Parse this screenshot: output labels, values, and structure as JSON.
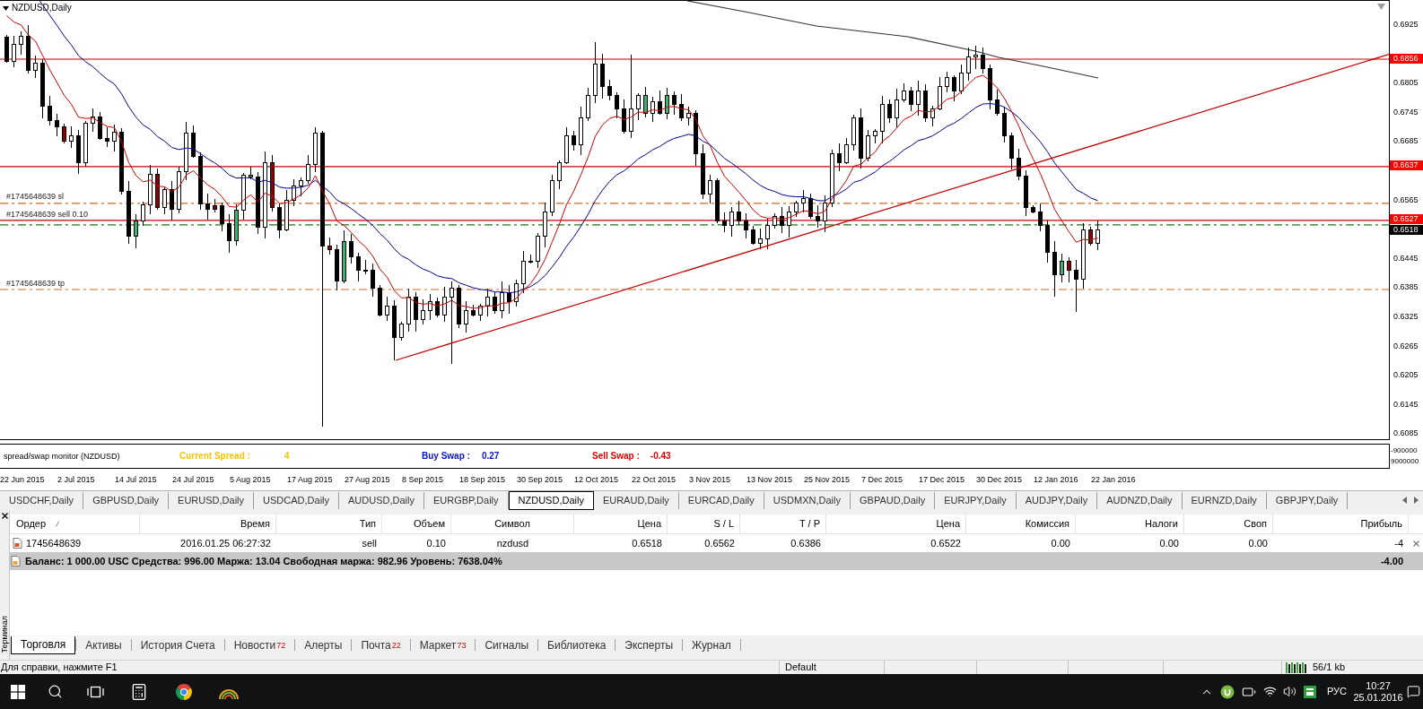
{
  "chart": {
    "title": "NZDUSD,Daily",
    "order_labels": [
      "#1745648639 sl",
      "#1745648639 sell 0.10",
      "#1745648639 tp"
    ],
    "price_axis": [
      "0.6925",
      "0.6805",
      "0.6745",
      "0.6685",
      "0.6565",
      "0.6445",
      "0.6385",
      "0.6325",
      "0.6265",
      "0.6205",
      "0.6145",
      "0.6085"
    ],
    "price_tags": [
      {
        "text": "0.6856",
        "kind": "level"
      },
      {
        "text": "0.6637",
        "kind": "level"
      },
      {
        "text": "0.6527",
        "kind": "level"
      },
      {
        "text": "0.6518",
        "kind": "bid"
      }
    ]
  },
  "indicator": {
    "name": "spread/swap monitor (NZDUSD)",
    "readouts": [
      {
        "label": "Current Spread :",
        "value": "4",
        "color": "#f5c400"
      },
      {
        "label": "Buy Swap :",
        "value": "0.27",
        "color": "#0a14c8"
      },
      {
        "label": "Sell Swap :",
        "value": "-0.43",
        "color": "#e00000"
      }
    ],
    "axis": [
      "-900000",
      "9000000"
    ]
  },
  "time_axis": [
    "22 Jun 2015",
    "2 Jul 2015",
    "14 Jul 2015",
    "24 Jul 2015",
    "5 Aug 2015",
    "17 Aug 2015",
    "27 Aug 2015",
    "8 Sep 2015",
    "18 Sep 2015",
    "30 Sep 2015",
    "12 Oct 2015",
    "22 Oct 2015",
    "3 Nov 2015",
    "13 Nov 2015",
    "25 Nov 2015",
    "7 Dec 2015",
    "17 Dec 2015",
    "30 Dec 2015",
    "12 Jan 2016",
    "22 Jan 2016"
  ],
  "chart_tabs": [
    {
      "label": "USDCHF,Daily",
      "selected": false
    },
    {
      "label": "GBPUSD,Daily",
      "selected": false
    },
    {
      "label": "EURUSD,Daily",
      "selected": false
    },
    {
      "label": "USDCAD,Daily",
      "selected": false
    },
    {
      "label": "AUDUSD,Daily",
      "selected": false
    },
    {
      "label": "EURGBP,Daily",
      "selected": false
    },
    {
      "label": "NZDUSD,Daily",
      "selected": true
    },
    {
      "label": "EURAUD,Daily",
      "selected": false
    },
    {
      "label": "EURCAD,Daily",
      "selected": false
    },
    {
      "label": "USDMXN,Daily",
      "selected": false
    },
    {
      "label": "GBPAUD,Daily",
      "selected": false
    },
    {
      "label": "EURJPY,Daily",
      "selected": false
    },
    {
      "label": "AUDJPY,Daily",
      "selected": false
    },
    {
      "label": "AUDNZD,Daily",
      "selected": false
    },
    {
      "label": "EURNZD,Daily",
      "selected": false
    },
    {
      "label": "GBPJPY,Daily",
      "selected": false
    }
  ],
  "terminal": {
    "title": "Терминал",
    "columns": [
      "Ордер",
      "Время",
      "Тип",
      "Объем",
      "Символ",
      "Цена",
      "S / L",
      "T / P",
      "Цена",
      "Комиссия",
      "Налоги",
      "Своп",
      "Прибыль"
    ],
    "rows": [
      {
        "cells": [
          "1745648639",
          "2016.01.25 06:27:32",
          "sell",
          "0.10",
          "nzdusd",
          "0.6518",
          "0.6562",
          "0.6386",
          "0.6522",
          "0.00",
          "0.00",
          "0.00",
          "-4"
        ]
      }
    ],
    "balance": {
      "text": "Баланс: 1 000.00 USC  Средства: 996.00  Маржа: 13.04  Свободная маржа: 982.96  Уровень: 7638.04%",
      "profit": "-4.00"
    },
    "tabs": [
      {
        "label": "Торговля",
        "selected": true
      },
      {
        "label": "Активы",
        "selected": false
      },
      {
        "label": "История Счета",
        "selected": false
      },
      {
        "label": "Новости",
        "count": "72",
        "selected": false
      },
      {
        "label": "Алерты",
        "selected": false
      },
      {
        "label": "Почта",
        "count": "22",
        "selected": false
      },
      {
        "label": "Маркет",
        "count": "73",
        "selected": false
      },
      {
        "label": "Сигналы",
        "selected": false
      },
      {
        "label": "Библиотека",
        "selected": false
      },
      {
        "label": "Эксперты",
        "selected": false
      },
      {
        "label": "Журнал",
        "selected": false
      }
    ]
  },
  "status_bar": {
    "help": "Для справки, нажмите F1",
    "profile": "Default",
    "traffic": "56/1 kb"
  },
  "taskbar": {
    "language": "РУС",
    "time": "10:27",
    "date": "25.01.2016"
  }
}
